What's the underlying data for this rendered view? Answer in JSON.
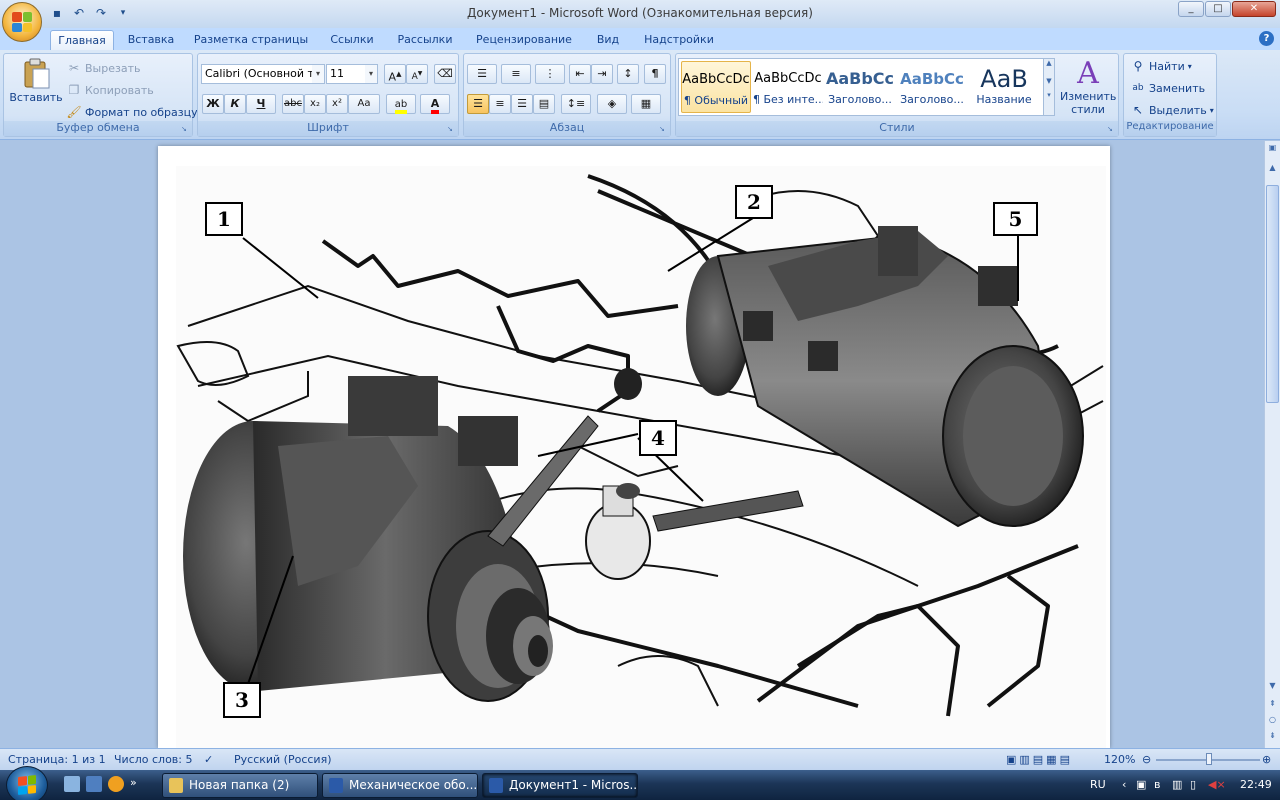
{
  "window": {
    "title": "Документ1 - Microsoft Word (Ознакомительная версия)"
  },
  "quick_access": {
    "icons": [
      "save-icon",
      "undo-icon",
      "redo-icon",
      "customize-icon"
    ]
  },
  "tabs": [
    "Главная",
    "Вставка",
    "Разметка страницы",
    "Ссылки",
    "Рассылки",
    "Рецензирование",
    "Вид",
    "Надстройки"
  ],
  "clipboard": {
    "paste": "Вставить",
    "cut": "Вырезать",
    "copy": "Копировать",
    "format_painter": "Формат по образцу",
    "label": "Буфер обмена"
  },
  "font": {
    "name": "Calibri (Основной те",
    "size": "11",
    "label": "Шрифт",
    "bold": "Ж",
    "italic": "К",
    "underline": "Ч",
    "strike": "abc",
    "sub": "x₂",
    "sup": "x²",
    "case": "Aa",
    "grow": "A",
    "shrink": "A"
  },
  "paragraph": {
    "label": "Абзац",
    "pilcrow": "¶"
  },
  "styles": {
    "label": "Стили",
    "items": [
      {
        "sample": "AaBbCcDc",
        "name": "¶ Обычный"
      },
      {
        "sample": "AaBbCcDc",
        "name": "¶ Без инте..."
      },
      {
        "sample": "AaBbCc",
        "name": "Заголово..."
      },
      {
        "sample": "AaBbCc",
        "name": "Заголово..."
      },
      {
        "sample": "AaB",
        "name": "Название"
      }
    ],
    "change": "Изменить стили"
  },
  "editing": {
    "label": "Редактирование",
    "find": "Найти",
    "replace": "Заменить",
    "select": "Выделить"
  },
  "figure": {
    "labels": [
      "1",
      "2",
      "3",
      "4",
      "5"
    ]
  },
  "status": {
    "page": "Страница: 1 из 1",
    "words": "Число слов: 5",
    "language": "Русский (Россия)",
    "zoom": "120%",
    "zoom_level": 0.5
  },
  "taskbar": {
    "items": [
      {
        "label": "Новая папка (2)"
      },
      {
        "label": "Механическое обо..."
      },
      {
        "label": "Документ1 - Micros..."
      }
    ],
    "lang": "RU",
    "time": "22:49"
  },
  "colors": {
    "highlight": "#ffff00",
    "font_color": "#ff0000",
    "office_accent": "#f3b53d"
  }
}
